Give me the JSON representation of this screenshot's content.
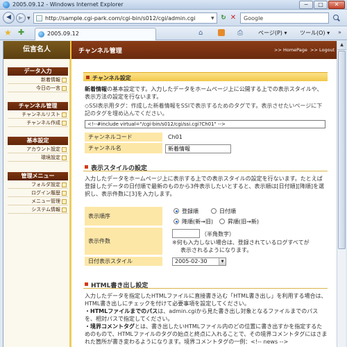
{
  "window": {
    "title": "2005.09.12 - Windows Internet Explorer",
    "min": "−",
    "max": "□",
    "close": "✕"
  },
  "address": {
    "url": "http://sample.cgi-park.com/cgi-bin/s012/cgi/admin.cgi",
    "search_placeholder": "Google"
  },
  "tab": {
    "label": "2005.09.12"
  },
  "toolbar": {
    "page_label": "ページ(P) ▾",
    "tools_label": "ツール(O) ▾",
    "more": "»"
  },
  "site": {
    "logo": "伝言名人",
    "page_title": "チャンネル管理",
    "home_link": ">> HomePage",
    "logout_link": ">> Logout"
  },
  "sidebar": {
    "groups": [
      {
        "title": "データ入力",
        "items": [
          "新着情報",
          "今日の一言"
        ]
      },
      {
        "title": "チャンネル管理",
        "items": [
          "チャンネルリスト",
          "チャンネル作成"
        ]
      },
      {
        "title": "基本設定",
        "items": [
          "アカウント設定",
          "環境設定"
        ]
      },
      {
        "title": "管理メニュー",
        "items": [
          "フォルダ設定",
          "ログイン履歴",
          "メニュー管理",
          "システム情報"
        ]
      }
    ]
  },
  "channel_settings": {
    "heading": "チャンネル設定",
    "intro_bold": "新着情報",
    "intro_rest": "の基本設定です。入力したデータをホームページ上に公開する上での表示スタイルや、表示方法の設定を行ないます。",
    "ssi_label": "◇SSI表示用タグ",
    "ssi_desc": "：作成した新着情報をSSIで表示するためのタグです。表示させたいページに下記のタグを埋め込んでください。",
    "ssi_tag": "<!--#include virtual=\"/cgi-bin/s012/cgi/ssi.cgi?Ch01\" -->",
    "code_label": "チャンネルコード",
    "code_value": "Ch01",
    "name_label": "チャンネル名",
    "name_value": "新着情報"
  },
  "display_style": {
    "heading": "表示スタイルの設定",
    "desc": "入力したデータをホームページ上に表示する上での表示スタイルの設定を行ないます。たとえば登録したデータの日付順で最新のものから3件表示したいとすると、表示順は[日付順][降順]を選択し、表示件数に[3]を入力します。",
    "order_label": "表示順序",
    "order_opt1": "登録順",
    "order_opt2": "日付順",
    "order_opt3": "降順(新→旧)",
    "order_opt4": "昇順(旧→新)",
    "count_label": "表示件数",
    "count_value": "",
    "count_hint1": "（半角数字）",
    "count_hint2": "※何も入力しない場合は、登録されているログすべてが",
    "count_hint3": "表示されるようになります。",
    "date_label": "日付表示スタイル",
    "date_value": "2005-02-30"
  },
  "html_output": {
    "heading": "HTML書き出し設定",
    "line1": "入力したデータを指定したHTMLファイルに直接書き込む「HTML書き出し」を利用する場合は、HTML書き出しにチェックを付けて必要事項を設定してください。",
    "line2_bold": "・HTMLファイルまでのパス",
    "line2_rest": "は、admin.cgiから見た書き出し対象となるファイルまでのパスを、相対パスで指定してください。",
    "line3_bold": "・境界コメントタグ",
    "line3_rest": "とは、書き出したいHTMLファイル内のどの位置に書き出すかを指定するためのもので、HTMLファイルのタグの始点と終点に入れることで、その境界コメントタグにはさまれた箇所が書き変わるようになります。境界コメントタグの一例：<!-- news -->"
  }
}
